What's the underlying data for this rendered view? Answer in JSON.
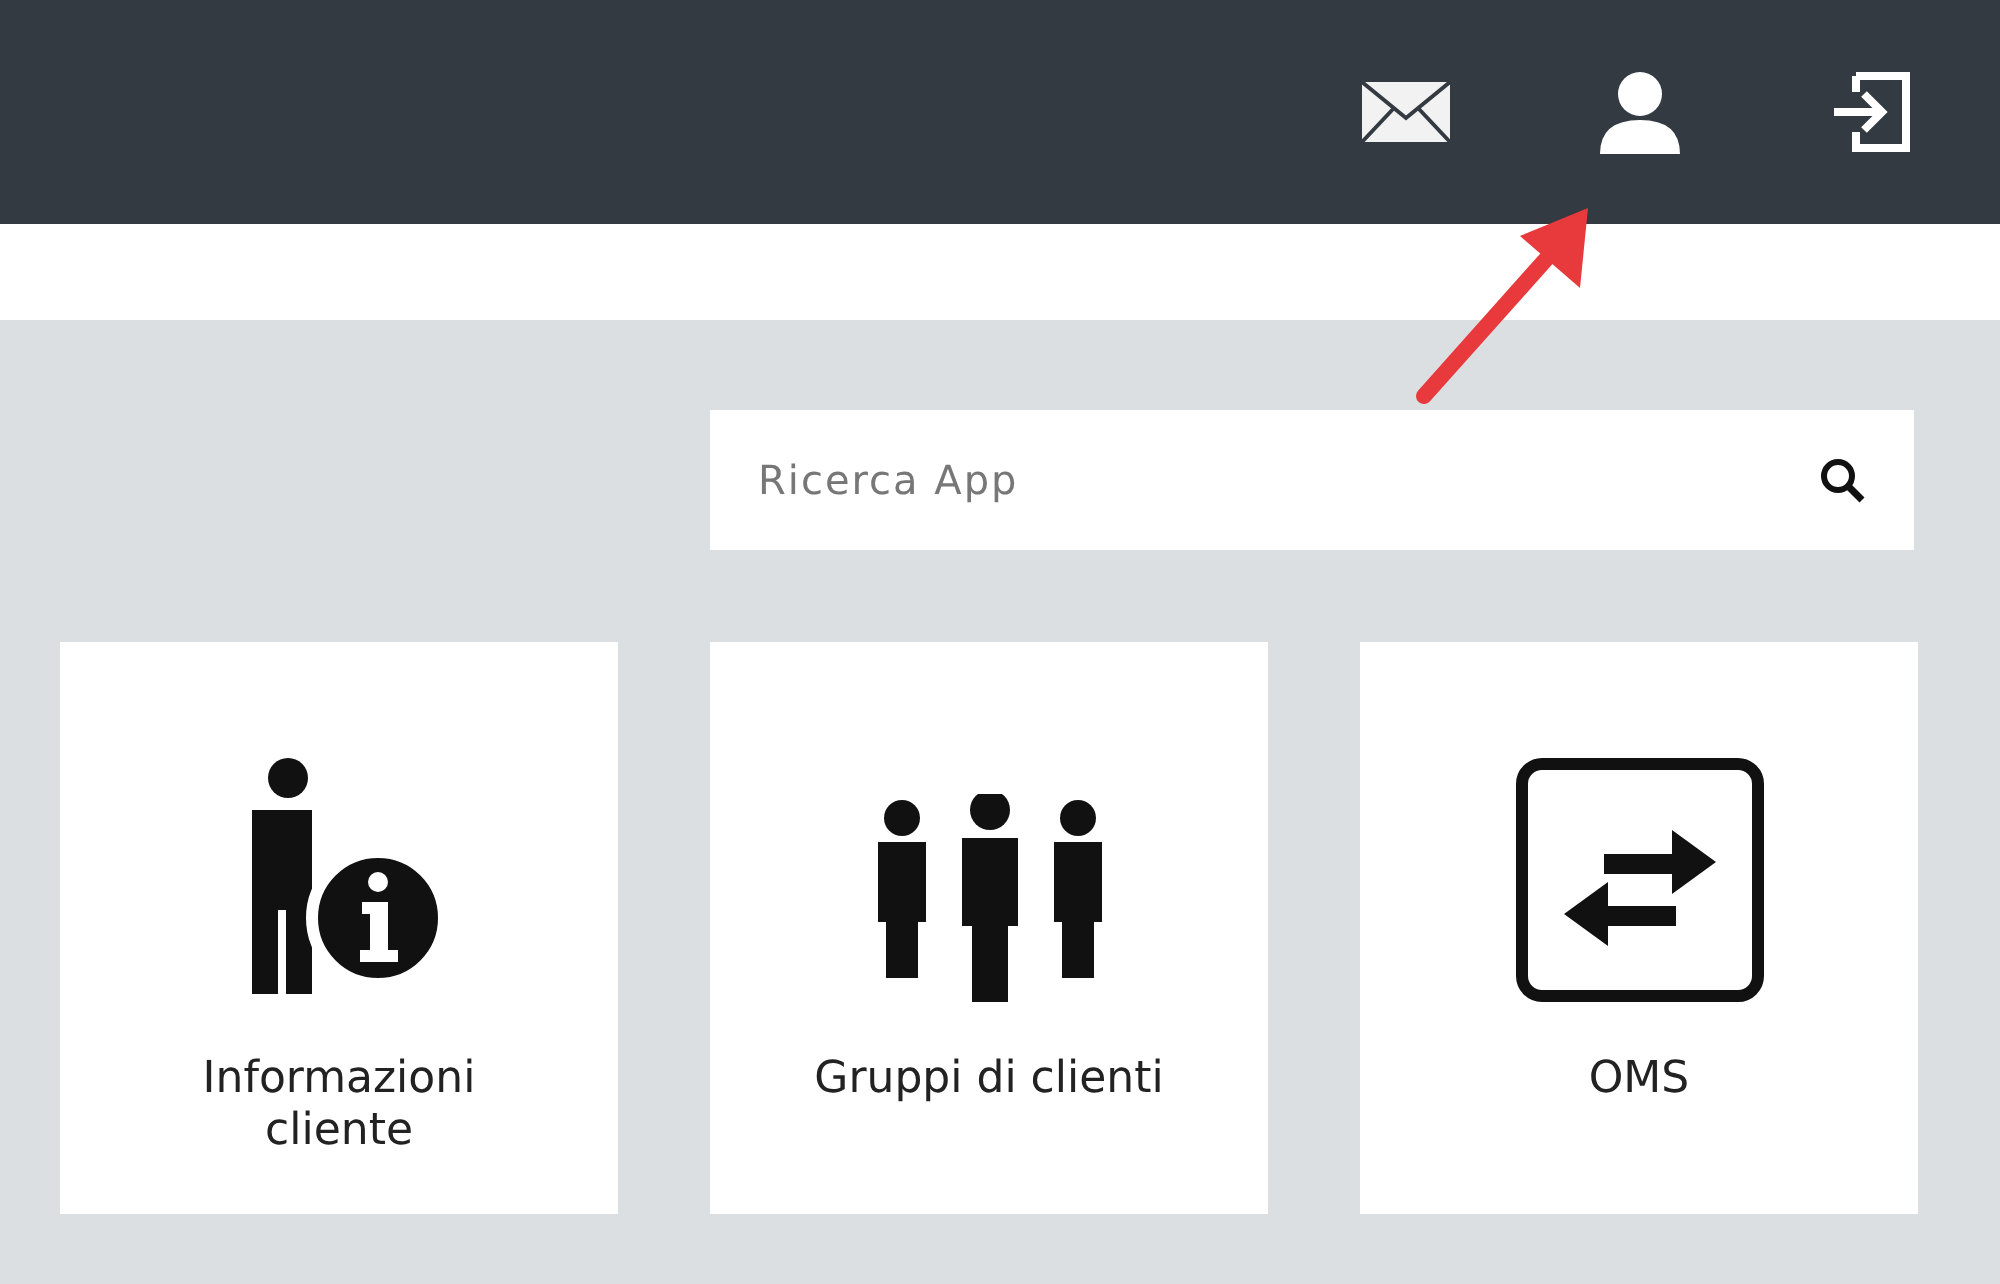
{
  "search": {
    "placeholder": "Ricerca App"
  },
  "apps": [
    {
      "label": "Informazioni cliente",
      "kind": "customer-info"
    },
    {
      "label": "Gruppi di clienti",
      "kind": "customer-groups"
    },
    {
      "label": "OMS",
      "kind": "exchange"
    }
  ]
}
